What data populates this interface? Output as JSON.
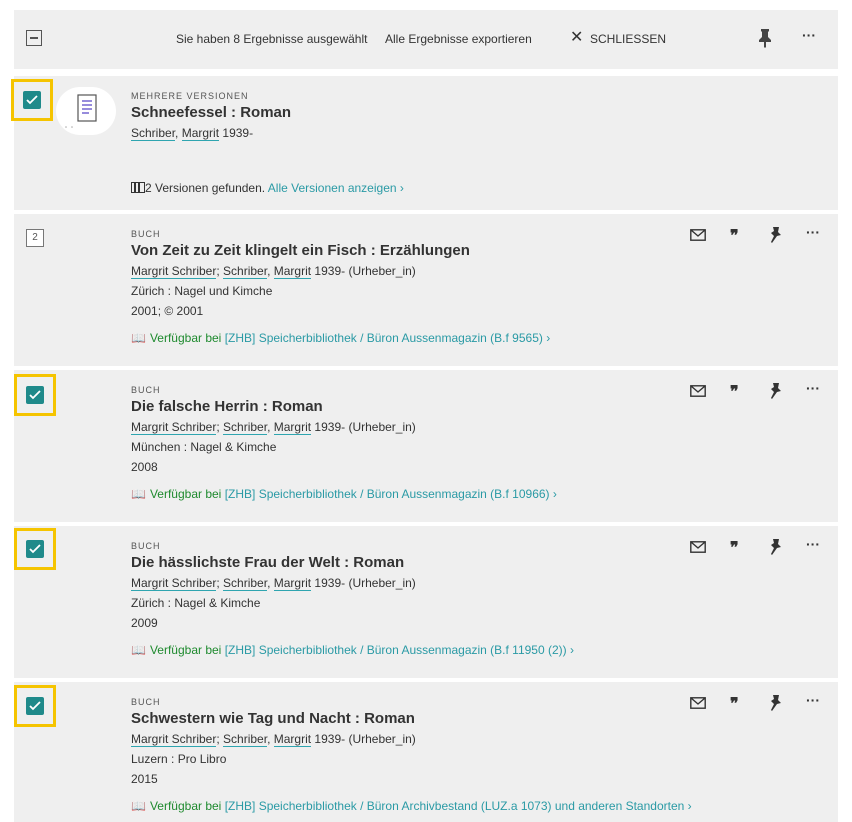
{
  "topbar": {
    "selected_text": "Sie haben 8 Ergebnisse ausgewählt",
    "export_label": "Alle Ergebnisse exportieren",
    "close_label": "SCHLIESSEN"
  },
  "records": [
    {
      "type": "MEHRERE VERSIONEN",
      "title": "Schneefessel : Roman",
      "author_a": "Schriber",
      "author_b": "Margrit",
      "author_rest": "1939-",
      "versions_text": "2 Versionen gefunden.",
      "versions_link": "Alle Versionen anzeigen"
    },
    {
      "number": "2",
      "type": "BUCH",
      "title": "Von Zeit zu Zeit klingelt ein Fisch : Erzählungen",
      "author_full": "Margrit Schriber",
      "author_a": "Schriber",
      "author_b": "Margrit",
      "author_rest": "1939- (Urheber_in)",
      "publisher": "Zürich : Nagel und Kimche",
      "year": "2001; © 2001",
      "avail_green": "Verfügbar bei",
      "avail_teal": "[ZHB] Speicherbibliothek / Büron  Aussenmagazin (B.f 9565)"
    },
    {
      "type": "BUCH",
      "title": "Die falsche Herrin : Roman",
      "author_full": "Margrit Schriber",
      "author_a": "Schriber",
      "author_b": "Margrit",
      "author_rest": "1939- (Urheber_in)",
      "publisher": "München : Nagel & Kimche",
      "year": "2008",
      "avail_green": "Verfügbar bei",
      "avail_teal": "[ZHB] Speicherbibliothek / Büron  Aussenmagazin (B.f 10966)"
    },
    {
      "type": "BUCH",
      "title": "Die hässlichste Frau der Welt : Roman",
      "author_full": "Margrit Schriber",
      "author_a": "Schriber",
      "author_b": "Margrit",
      "author_rest": "1939- (Urheber_in)",
      "publisher": "Zürich : Nagel & Kimche",
      "year": "2009",
      "avail_green": "Verfügbar bei",
      "avail_teal": "[ZHB] Speicherbibliothek / Büron  Aussenmagazin (B.f 11950 (2))"
    },
    {
      "type": "BUCH",
      "title": "Schwestern wie Tag und Nacht : Roman",
      "author_full": "Margrit Schriber",
      "author_a": "Schriber",
      "author_b": "Margrit",
      "author_rest": "1939- (Urheber_in)",
      "publisher": "Luzern : Pro Libro",
      "year": "2015",
      "avail_green": "Verfügbar bei",
      "avail_teal": "[ZHB] Speicherbibliothek / Büron  Archivbestand (LUZ.a 1073) und anderen Standorten"
    }
  ],
  "colors": {
    "panel": "#efefef",
    "highlight": "#f5c400",
    "checkbox": "#1f8a8a",
    "available": "#1e8a2e",
    "link": "#2a9aa5"
  },
  "icons": [
    "minus-checkbox-icon",
    "close-icon",
    "pin-icon",
    "more-icon",
    "document-icon",
    "versions-icon",
    "mail-icon",
    "quote-icon",
    "chevron-right-icon",
    "book-icon",
    "check-icon"
  ]
}
